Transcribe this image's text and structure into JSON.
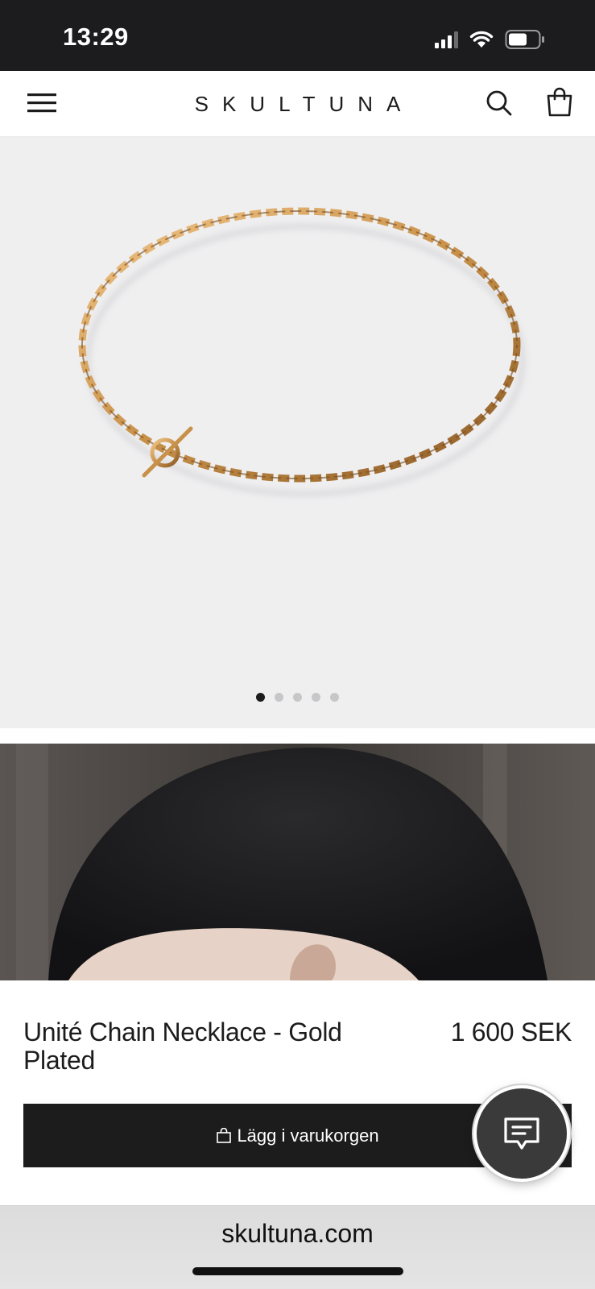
{
  "status_bar": {
    "time": "13:29"
  },
  "header": {
    "brand": "SKULTUNA"
  },
  "gallery": {
    "slide_count": 5,
    "active_slide": 1
  },
  "product": {
    "title": "Unité Chain Necklace - Gold Plated",
    "price": "1 600 SEK",
    "add_to_cart_label": "Lägg i varukorgen"
  },
  "browser": {
    "url": "skultuna.com"
  },
  "colors": {
    "dark": "#1c1c1c",
    "gallery_bg": "#efeff0",
    "gold": "#c8914a"
  }
}
